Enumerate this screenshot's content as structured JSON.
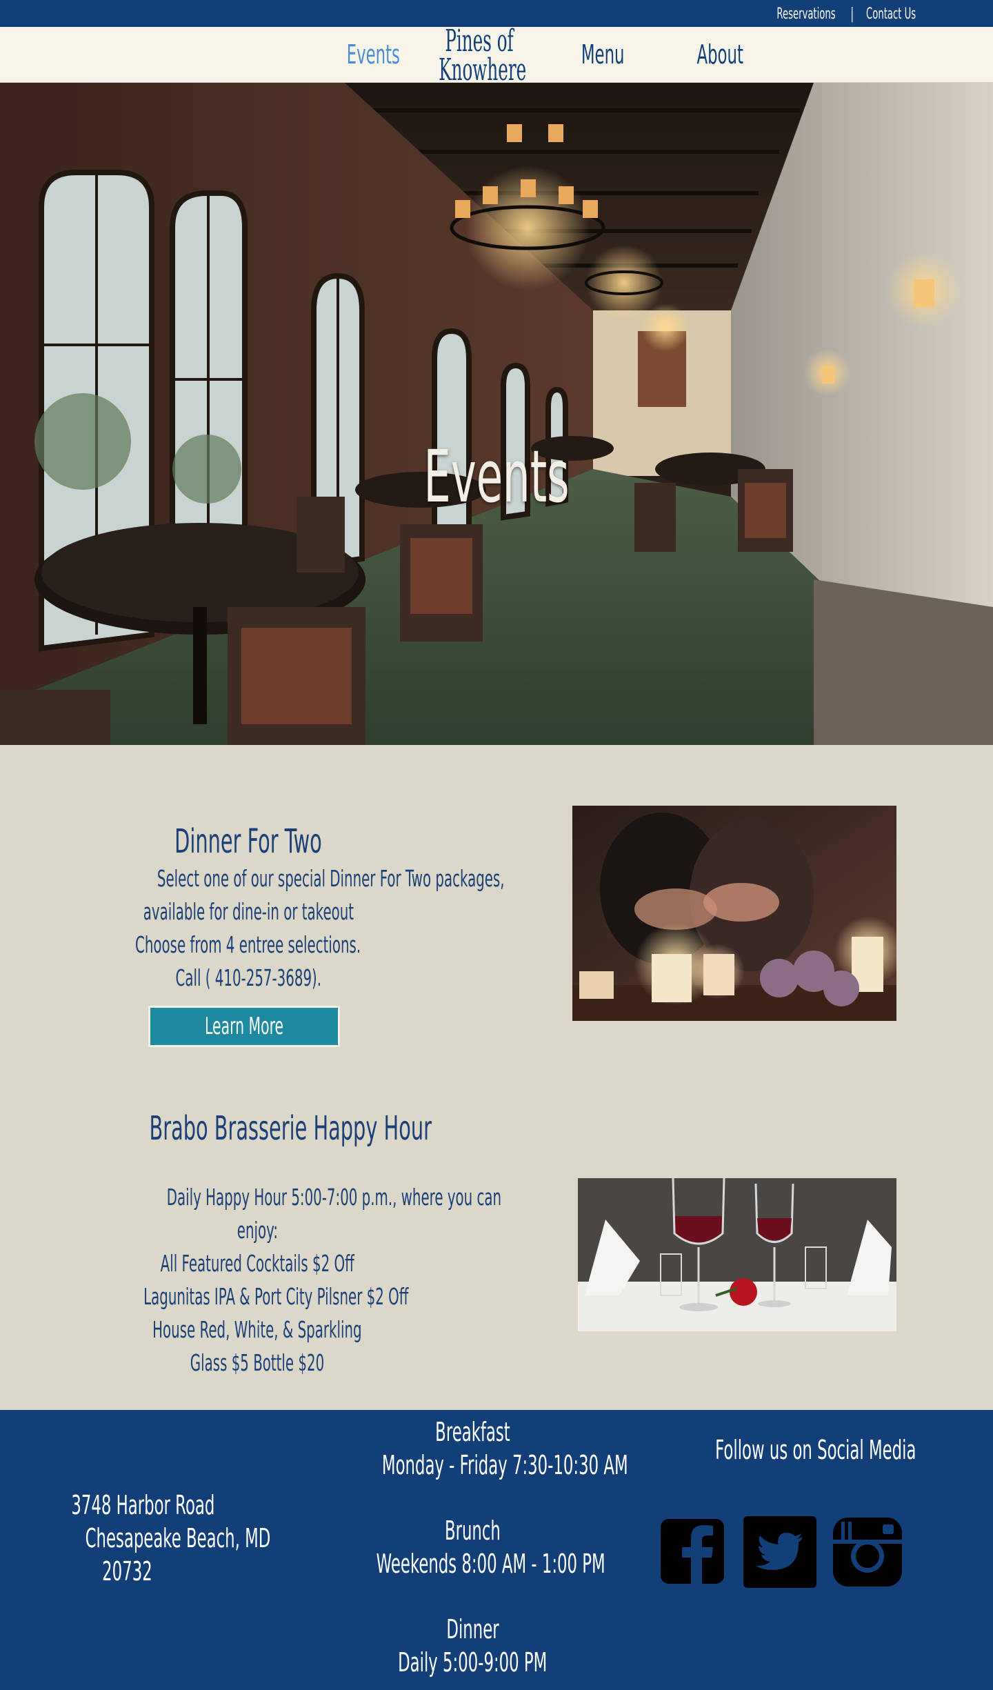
{
  "topbar": {
    "reservations": "Reservations",
    "separator": "|",
    "contact": "Contact Us"
  },
  "nav": {
    "events": "Events",
    "brand_line1": "Pines of",
    "brand_line2": "Knowhere",
    "menu": "Menu",
    "about": "About"
  },
  "hero": {
    "title": "Events"
  },
  "dinner": {
    "title": "Dinner For Two",
    "lines": [
      "Select one of our special Dinner For Two packages,",
      "available for dine-in or takeout",
      "Choose from 4 entree selections.",
      "Call ( 410-257-3689)."
    ],
    "button": "Learn More"
  },
  "happy": {
    "title": "Brabo Brasserie Happy Hour",
    "lines": [
      "Daily Happy Hour 5:00-7:00 p.m., where you can",
      "enjoy:",
      "All Featured Cocktails $2 Off",
      "Lagunitas IPA & Port City Pilsner $2 Off",
      "House Red, White, & Sparkling",
      "Glass $5  Bottle $20"
    ]
  },
  "footer": {
    "address": [
      "3748 Harbor Road",
      "Chesapeake Beach, MD",
      "20732"
    ],
    "hours": {
      "breakfast_label": "Breakfast",
      "breakfast_time": "Monday - Friday  7:30-10:30 AM",
      "brunch_label": "Brunch",
      "brunch_time": "Weekends   8:00 AM - 1:00 PM",
      "dinner_label": "Dinner",
      "dinner_time": "Daily  5:00-9:00 PM"
    },
    "social_title": "Follow us on Social Media",
    "social_icons": [
      "facebook-icon",
      "twitter-icon",
      "instagram-icon"
    ]
  },
  "colors": {
    "navy": "#123f78",
    "cream": "#f7f4ea",
    "beige": "#dbd7c9",
    "teal_button": "#1e8aa0",
    "active_nav": "#4a8ed6"
  }
}
